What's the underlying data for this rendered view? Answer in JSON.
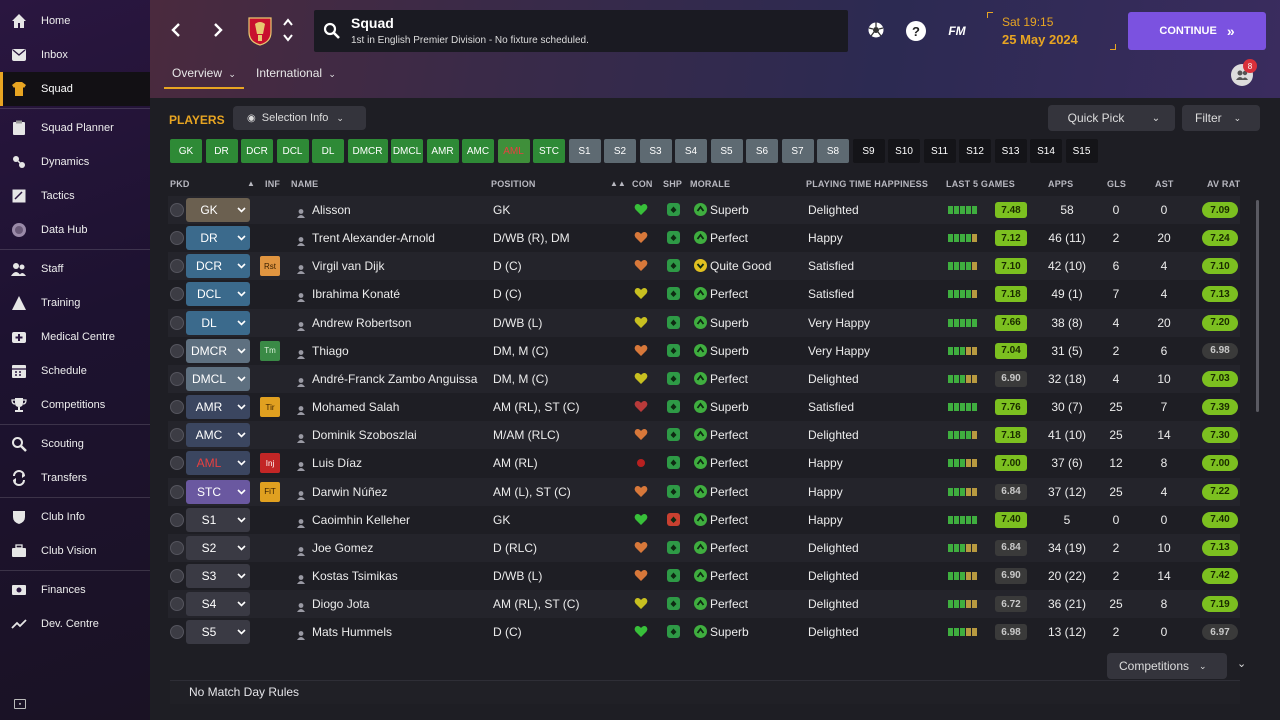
{
  "nav": {
    "items": [
      {
        "label": "Home",
        "icon": "home-icon"
      },
      {
        "label": "Inbox",
        "icon": "inbox-icon"
      },
      {
        "label": "Squad",
        "icon": "shirt-icon",
        "active": true
      },
      {
        "label": "Squad Planner",
        "icon": "clipboard-icon"
      },
      {
        "label": "Dynamics",
        "icon": "dynamics-icon"
      },
      {
        "label": "Tactics",
        "icon": "tactics-icon"
      },
      {
        "label": "Data Hub",
        "icon": "data-hub-icon"
      },
      {
        "label": "Staff",
        "icon": "staff-icon"
      },
      {
        "label": "Training",
        "icon": "training-icon"
      },
      {
        "label": "Medical Centre",
        "icon": "medical-icon"
      },
      {
        "label": "Schedule",
        "icon": "calendar-icon"
      },
      {
        "label": "Competitions",
        "icon": "trophy-icon"
      },
      {
        "label": "Scouting",
        "icon": "scouting-icon"
      },
      {
        "label": "Transfers",
        "icon": "transfers-icon"
      },
      {
        "label": "Club Info",
        "icon": "shield-icon"
      },
      {
        "label": "Club Vision",
        "icon": "briefcase-icon"
      },
      {
        "label": "Finances",
        "icon": "finances-icon"
      },
      {
        "label": "Dev. Centre",
        "icon": "dev-centre-icon"
      }
    ]
  },
  "header": {
    "title": "Squad",
    "subtitle": "1st in English Premier Division - No fixture scheduled.",
    "day_time": "Sat 19:15",
    "date": "25 May 2024",
    "continue_label": "CONTINUE",
    "fm_label": "FM",
    "notifications": "8"
  },
  "tabs": [
    {
      "label": "Overview"
    },
    {
      "label": "International"
    }
  ],
  "toolbar": {
    "players_label": "PLAYERS",
    "selection_info_label": "Selection Info",
    "quick_pick_label": "Quick Pick",
    "filter_label": "Filter"
  },
  "positions": [
    "GK",
    "DR",
    "DCR",
    "DCL",
    "DL",
    "DMCR",
    "DMCL",
    "AMR",
    "AMC",
    "AML",
    "STC",
    "S1",
    "S2",
    "S3",
    "S4",
    "S5",
    "S6",
    "S7",
    "S8",
    "S9",
    "S10",
    "S11",
    "S12",
    "S13",
    "S14",
    "S15"
  ],
  "columns": {
    "pkd": "PKD",
    "inf": "INF",
    "name": "NAME",
    "position": "POSITION",
    "con": "CON",
    "shp": "SHP",
    "morale": "MORALE",
    "pth": "PLAYING TIME HAPPINESS",
    "last5": "LAST 5 GAMES",
    "apps": "APPS",
    "gls": "GLS",
    "ast": "AST",
    "avrat": "AV RAT"
  },
  "players": [
    {
      "sel": "GK",
      "inf": "",
      "name": "Alisson",
      "position": "GK",
      "con": "green",
      "morale": "Superb",
      "pth": "Delighted",
      "form": "7.48",
      "apps": "58",
      "gls": "0",
      "ast": "0",
      "avrat": "7.09"
    },
    {
      "sel": "DR",
      "inf": "",
      "name": "Trent Alexander-Arnold",
      "position": "D/WB (R), DM",
      "con": "orange",
      "morale": "Perfect",
      "pth": "Happy",
      "form": "7.12",
      "apps": "46 (11)",
      "gls": "2",
      "ast": "20",
      "avrat": "7.24"
    },
    {
      "sel": "DCR",
      "inf": "Rst",
      "name": "Virgil van Dijk",
      "position": "D (C)",
      "con": "orange",
      "morale": "Quite Good",
      "pth": "Satisfied",
      "form": "7.10",
      "apps": "42 (10)",
      "gls": "6",
      "ast": "4",
      "avrat": "7.10"
    },
    {
      "sel": "DCL",
      "inf": "",
      "name": "Ibrahima Konaté",
      "position": "D (C)",
      "con": "yellow",
      "morale": "Perfect",
      "pth": "Satisfied",
      "form": "7.18",
      "apps": "49 (1)",
      "gls": "7",
      "ast": "4",
      "avrat": "7.13"
    },
    {
      "sel": "DL",
      "inf": "",
      "name": "Andrew Robertson",
      "position": "D/WB (L)",
      "con": "yellow",
      "morale": "Superb",
      "pth": "Very Happy",
      "form": "7.66",
      "apps": "38 (8)",
      "gls": "4",
      "ast": "20",
      "avrat": "7.20"
    },
    {
      "sel": "DMCR",
      "inf": "Tm",
      "name": "Thiago",
      "position": "DM, M (C)",
      "con": "orange",
      "morale": "Superb",
      "pth": "Very Happy",
      "form": "7.04",
      "apps": "31 (5)",
      "gls": "2",
      "ast": "6",
      "avrat": "6.98"
    },
    {
      "sel": "DMCL",
      "inf": "",
      "name": "André-Franck Zambo Anguissa",
      "position": "DM, M (C)",
      "con": "yellow",
      "morale": "Perfect",
      "pth": "Delighted",
      "form": "6.90",
      "apps": "32 (18)",
      "gls": "4",
      "ast": "10",
      "avrat": "7.03"
    },
    {
      "sel": "AMR",
      "inf": "Tir",
      "name": "Mohamed Salah",
      "position": "AM (RL), ST (C)",
      "con": "red",
      "morale": "Superb",
      "pth": "Satisfied",
      "form": "7.76",
      "apps": "30 (7)",
      "gls": "25",
      "ast": "7",
      "avrat": "7.39"
    },
    {
      "sel": "AMC",
      "inf": "",
      "name": "Dominik Szoboszlai",
      "position": "M/AM (RLC)",
      "con": "orange",
      "morale": "Perfect",
      "pth": "Delighted",
      "form": "7.18",
      "apps": "41 (10)",
      "gls": "25",
      "ast": "14",
      "avrat": "7.30"
    },
    {
      "sel": "AML",
      "inf": "Inj",
      "name": "Luis Díaz",
      "position": "AM (RL)",
      "con": "injured",
      "morale": "Perfect",
      "pth": "Happy",
      "form": "7.00",
      "apps": "37 (6)",
      "gls": "12",
      "ast": "8",
      "avrat": "7.00"
    },
    {
      "sel": "STC",
      "inf": "FiT",
      "name": "Darwin Núñez",
      "position": "AM (L), ST (C)",
      "con": "orange",
      "morale": "Perfect",
      "pth": "Happy",
      "form": "6.84",
      "apps": "37 (12)",
      "gls": "25",
      "ast": "4",
      "avrat": "7.22"
    },
    {
      "sel": "S1",
      "inf": "",
      "name": "Caoimhin Kelleher",
      "position": "GK",
      "con": "green",
      "morale": "Perfect",
      "pth": "Happy",
      "form": "7.40",
      "apps": "5",
      "gls": "0",
      "ast": "0",
      "avrat": "7.40"
    },
    {
      "sel": "S2",
      "inf": "",
      "name": "Joe Gomez",
      "position": "D (RLC)",
      "con": "orange",
      "morale": "Perfect",
      "pth": "Delighted",
      "form": "6.84",
      "apps": "34 (19)",
      "gls": "2",
      "ast": "10",
      "avrat": "7.13"
    },
    {
      "sel": "S3",
      "inf": "",
      "name": "Kostas Tsimikas",
      "position": "D/WB (L)",
      "con": "orange",
      "morale": "Perfect",
      "pth": "Delighted",
      "form": "6.90",
      "apps": "20 (22)",
      "gls": "2",
      "ast": "14",
      "avrat": "7.42"
    },
    {
      "sel": "S4",
      "inf": "",
      "name": "Diogo Jota",
      "position": "AM (RL), ST (C)",
      "con": "yellow",
      "morale": "Perfect",
      "pth": "Delighted",
      "form": "6.72",
      "apps": "36 (21)",
      "gls": "25",
      "ast": "8",
      "avrat": "7.19"
    },
    {
      "sel": "S5",
      "inf": "",
      "name": "Mats Hummels",
      "position": "D (C)",
      "con": "green",
      "morale": "Superb",
      "pth": "Delighted",
      "form": "6.98",
      "apps": "13 (12)",
      "gls": "2",
      "ast": "0",
      "avrat": "6.97"
    }
  ],
  "footer": {
    "competitions_label": "Competitions",
    "match_day_rules": "No Match Day Rules"
  }
}
